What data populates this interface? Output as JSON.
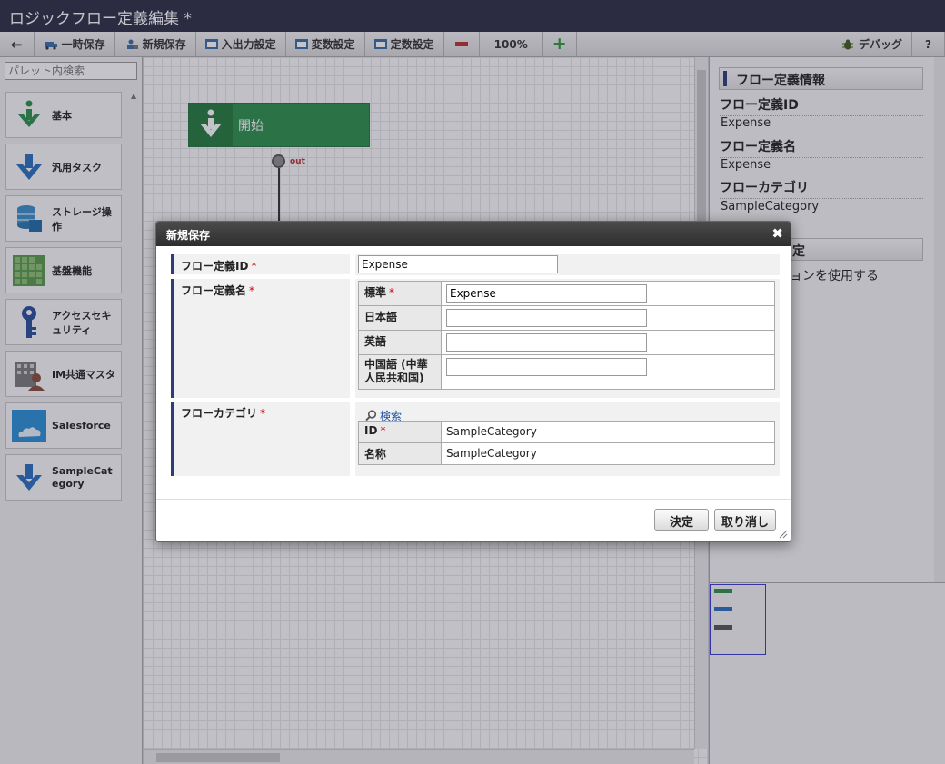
{
  "window": {
    "title": "ロジックフロー定義編集 *"
  },
  "toolbar": {
    "back_label": "←",
    "temp_save": "一時保存",
    "new_save": "新規保存",
    "io_settings": "入出力設定",
    "var_settings": "変数設定",
    "const_settings": "定数設定",
    "zoom": "100%",
    "debug": "デバッグ",
    "help": "?"
  },
  "palette": {
    "search_placeholder": "パレット内検索",
    "items": [
      {
        "label": "基本",
        "icon": "arrow-down-green-icon"
      },
      {
        "label": "汎用タスク",
        "icon": "arrow-down-blue-icon"
      },
      {
        "label": "ストレージ操作",
        "icon": "database-icon"
      },
      {
        "label": "基盤機能",
        "icon": "grid-blocks-icon"
      },
      {
        "label": "アクセスセキュリティ",
        "icon": "key-icon"
      },
      {
        "label": "IM共通マスタ",
        "icon": "user-building-icon"
      },
      {
        "label": "Salesforce",
        "icon": "salesforce-logo-icon"
      },
      {
        "label": "SampleCategory",
        "icon": "arrow-down-blue-icon"
      }
    ]
  },
  "canvas": {
    "start_node_label": "開始",
    "port_label": "out"
  },
  "properties": {
    "section_title": "フロー定義情報",
    "fields": [
      {
        "label": "フロー定義ID",
        "value": "Expense"
      },
      {
        "label": "フロー定義名",
        "value": "Expense"
      },
      {
        "label": "フローカテゴリ",
        "value": "SampleCategory"
      }
    ],
    "second_section_partial": "定",
    "partial_text": "ョンを使用する"
  },
  "dialog": {
    "title": "新規保存",
    "required_mark": "*",
    "flow_id": {
      "label": "フロー定義ID",
      "value": "Expense"
    },
    "flow_name": {
      "label": "フロー定義名",
      "locales": [
        {
          "label": "標準",
          "required": true,
          "value": "Expense"
        },
        {
          "label": "日本語",
          "required": false,
          "value": ""
        },
        {
          "label": "英語",
          "required": false,
          "value": ""
        },
        {
          "label": "中国語 (中華人民共和国)",
          "required": false,
          "value": ""
        }
      ]
    },
    "flow_category": {
      "label": "フローカテゴリ",
      "search_link": "検索",
      "id_label": "ID",
      "id_value": "SampleCategory",
      "name_label": "名称",
      "name_value": "SampleCategory"
    },
    "ok_button": "決定",
    "cancel_button": "取り消し"
  },
  "colors": {
    "title_bar": "#2d2d45",
    "start_node": "#2f8f4c",
    "accent_bar": "#2b3e78",
    "required": "#cc0000"
  }
}
